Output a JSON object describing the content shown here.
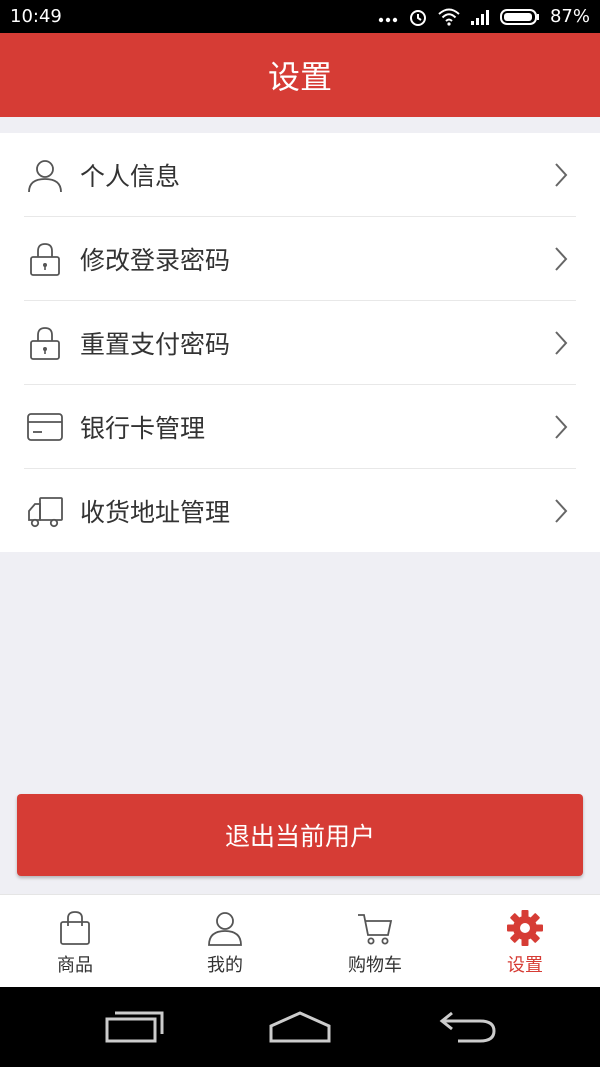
{
  "status_bar": {
    "time": "10:49",
    "battery": "87%"
  },
  "header": {
    "title": "设置"
  },
  "menu": {
    "items": [
      {
        "label": "个人信息",
        "icon": "person-icon"
      },
      {
        "label": "修改登录密码",
        "icon": "lock-icon"
      },
      {
        "label": "重置支付密码",
        "icon": "lock-icon"
      },
      {
        "label": "银行卡管理",
        "icon": "bank-card-icon"
      },
      {
        "label": "收货地址管理",
        "icon": "truck-icon"
      }
    ]
  },
  "logout": {
    "label": "退出当前用户"
  },
  "tab_bar": {
    "tabs": [
      {
        "label": "商品",
        "icon": "shopping-bag-icon",
        "active": false
      },
      {
        "label": "我的",
        "icon": "person-icon",
        "active": false
      },
      {
        "label": "购物车",
        "icon": "cart-icon",
        "active": false
      },
      {
        "label": "设置",
        "icon": "gear-icon",
        "active": true
      }
    ]
  },
  "colors": {
    "accent": "#d63c35",
    "background": "#efeff4"
  }
}
